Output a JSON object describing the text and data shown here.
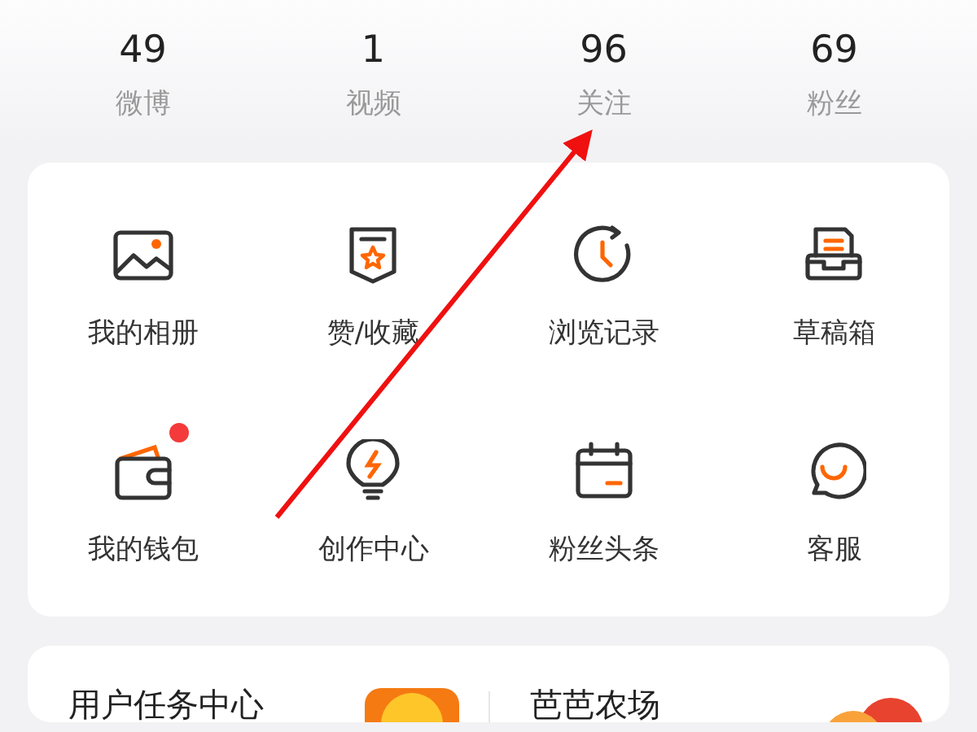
{
  "stats": [
    {
      "value": "49",
      "label": "微博"
    },
    {
      "value": "1",
      "label": "视频"
    },
    {
      "value": "96",
      "label": "关注"
    },
    {
      "value": "69",
      "label": "粉丝"
    }
  ],
  "shortcuts": [
    {
      "kind": "album",
      "label": "我的相册",
      "badge": false
    },
    {
      "kind": "favorites",
      "label": "赞/收藏",
      "badge": false
    },
    {
      "kind": "history",
      "label": "浏览记录",
      "badge": false
    },
    {
      "kind": "drafts",
      "label": "草稿箱",
      "badge": false
    },
    {
      "kind": "wallet",
      "label": "我的钱包",
      "badge": true
    },
    {
      "kind": "creator",
      "label": "创作中心",
      "badge": false
    },
    {
      "kind": "headlines",
      "label": "粉丝头条",
      "badge": false
    },
    {
      "kind": "service",
      "label": "客服",
      "badge": false
    }
  ],
  "promos": [
    {
      "kind": "coin",
      "title": "用户任务中心"
    },
    {
      "kind": "fruit",
      "title": "芭芭农场"
    }
  ]
}
